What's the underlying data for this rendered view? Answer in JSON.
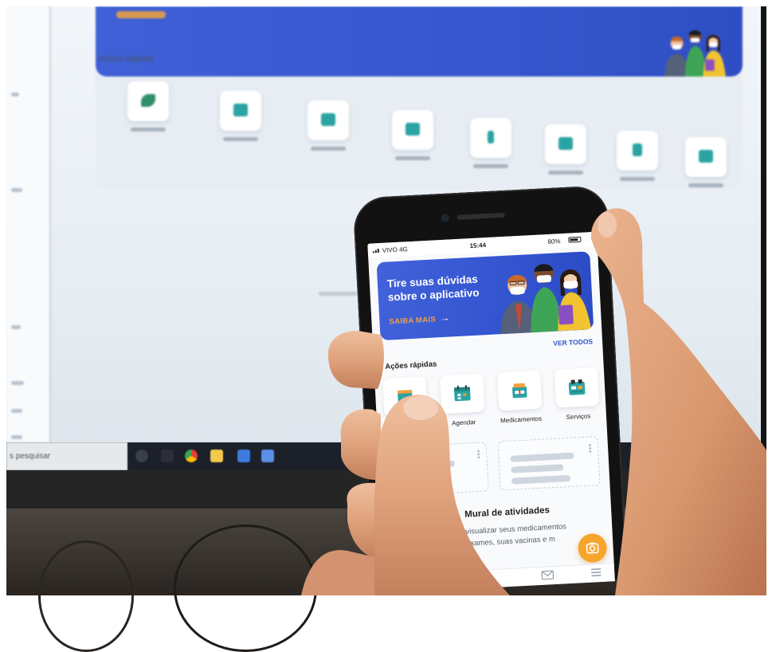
{
  "monitor": {
    "quick_actions_title": "Ações rápidas",
    "taskbar_search": "s pesquisar",
    "colors": {
      "banner": "#3555cc",
      "tile_glyph": "#2aa3a3",
      "taskbar": "#1c2029"
    }
  },
  "phone": {
    "status": {
      "carrier": "VIVO 4G",
      "time": "15:44",
      "battery": "80%"
    },
    "banner": {
      "line1": "Tire suas dúvidas",
      "line2": "sobre o aplicativo",
      "cta": "SAIBA MAIS",
      "cta_arrow": "→"
    },
    "see_all": "VER TODOS",
    "quick_actions": {
      "title": "Ações rápidas",
      "items": [
        {
          "icon": "quick-action-icon"
        },
        {
          "label": "Agendar",
          "icon": "calendar-icon"
        },
        {
          "label": "Medicamentos",
          "icon": "medicine-box-icon"
        },
        {
          "label": "Serviços",
          "icon": "services-icon"
        }
      ]
    },
    "mural": {
      "title": "Mural de atividades",
      "line1": "visualizar seus medicamentos",
      "line2": "exames, suas vacinas e m"
    },
    "fab_icon": "camera-icon",
    "bottom_nav_icons": [
      "mail-icon",
      "menu-icon"
    ],
    "colors": {
      "primary": "#3354cf",
      "accent": "#f5a03a",
      "fab": "#f6a52c",
      "icon_teal": "#2aa3a3"
    }
  }
}
